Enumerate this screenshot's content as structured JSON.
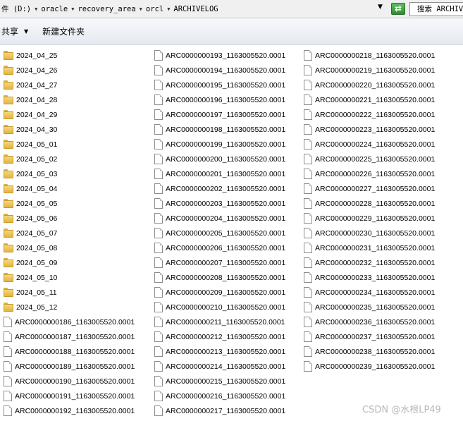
{
  "address_bar": {
    "crumbs": [
      "件 (D:)",
      "oracle",
      "recovery_area",
      "orcl",
      "ARCHIVELOG"
    ],
    "search_text": "搜索 ARCHIVELOG"
  },
  "toolbar": {
    "share_label": "共享",
    "new_folder_label": "新建文件夹"
  },
  "folders": [
    "2024_04_25",
    "2024_04_26",
    "2024_04_27",
    "2024_04_28",
    "2024_04_29",
    "2024_04_30",
    "2024_05_01",
    "2024_05_02",
    "2024_05_03",
    "2024_05_04",
    "2024_05_05",
    "2024_05_06",
    "2024_05_07",
    "2024_05_08",
    "2024_05_09",
    "2024_05_10",
    "2024_05_11",
    "2024_05_12"
  ],
  "files": [
    "ARC0000000186_1163005520.0001",
    "ARC0000000187_1163005520.0001",
    "ARC0000000188_1163005520.0001",
    "ARC0000000189_1163005520.0001",
    "ARC0000000190_1163005520.0001",
    "ARC0000000191_1163005520.0001",
    "ARC0000000192_1163005520.0001",
    "ARC0000000193_1163005520.0001",
    "ARC0000000194_1163005520.0001",
    "ARC0000000195_1163005520.0001",
    "ARC0000000196_1163005520.0001",
    "ARC0000000197_1163005520.0001",
    "ARC0000000198_1163005520.0001",
    "ARC0000000199_1163005520.0001",
    "ARC0000000200_1163005520.0001",
    "ARC0000000201_1163005520.0001",
    "ARC0000000202_1163005520.0001",
    "ARC0000000203_1163005520.0001",
    "ARC0000000204_1163005520.0001",
    "ARC0000000205_1163005520.0001",
    "ARC0000000206_1163005520.0001",
    "ARC0000000207_1163005520.0001",
    "ARC0000000208_1163005520.0001",
    "ARC0000000209_1163005520.0001",
    "ARC0000000210_1163005520.0001",
    "ARC0000000211_1163005520.0001",
    "ARC0000000212_1163005520.0001",
    "ARC0000000213_1163005520.0001",
    "ARC0000000214_1163005520.0001",
    "ARC0000000215_1163005520.0001",
    "ARC0000000216_1163005520.0001",
    "ARC0000000217_1163005520.0001",
    "ARC0000000218_1163005520.0001",
    "ARC0000000219_1163005520.0001",
    "ARC0000000220_1163005520.0001",
    "ARC0000000221_1163005520.0001",
    "ARC0000000222_1163005520.0001",
    "ARC0000000223_1163005520.0001",
    "ARC0000000224_1163005520.0001",
    "ARC0000000225_1163005520.0001",
    "ARC0000000226_1163005520.0001",
    "ARC0000000227_1163005520.0001",
    "ARC0000000228_1163005520.0001",
    "ARC0000000229_1163005520.0001",
    "ARC0000000230_1163005520.0001",
    "ARC0000000231_1163005520.0001",
    "ARC0000000232_1163005520.0001",
    "ARC0000000233_1163005520.0001",
    "ARC0000000234_1163005520.0001",
    "ARC0000000235_1163005520.0001",
    "ARC0000000236_1163005520.0001",
    "ARC0000000237_1163005520.0001",
    "ARC0000000238_1163005520.0001",
    "ARC0000000239_1163005520.0001"
  ],
  "icons": {
    "folder": "folder-icon",
    "file": "file-icon",
    "refresh": "refresh-icon",
    "dropdown": "chevron-down-icon"
  },
  "watermark": "CSDN @水根LP49"
}
